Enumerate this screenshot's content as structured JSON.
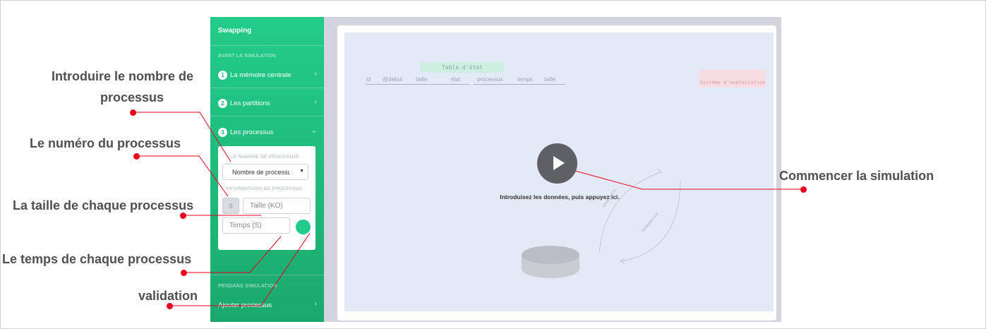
{
  "sidebar": {
    "title": "Swapping",
    "section_before": "AVANT LA SIMULATION",
    "items": [
      {
        "num": "1",
        "label": "La mémoire centrale",
        "chevron": "›"
      },
      {
        "num": "2",
        "label": "Les partitions",
        "chevron": "›"
      },
      {
        "num": "3",
        "label": "Les processus",
        "chevron": "⌄"
      }
    ],
    "panel": {
      "nb_label": "LE NOMBRE DE PROCESSUS:",
      "nb_select_value": "Nombre de processus",
      "info_label": "INFORMATIONS DU PROCESSUS:",
      "process_number": "0",
      "size_placeholder": "Taille (KO)",
      "time_placeholder": "Temps (S)"
    },
    "section_during": "PENDANS SIMULATION",
    "add_item": {
      "label": "Ajouter processus",
      "chevron": "›"
    }
  },
  "main": {
    "table_title": "Table d'état",
    "table_headers": [
      "id",
      "@debut",
      "taille",
      "état",
      "processus",
      "temps",
      "taille"
    ],
    "os_label": "Système d'exploitation",
    "intro_text": "Introduisez les données, puis appuyez ici.",
    "swap_in_label": "swapped in",
    "swap_out_label": "swapped out"
  },
  "annotations": {
    "nb_processus": "Introduire le nombre de processus",
    "nb_processus_line1": "Introduire le nombre de",
    "nb_processus_line2": "processus",
    "numero": "Le numéro du processus",
    "taille": "La taille de chaque processus",
    "temps": "Le temps de chaque processus",
    "validation": "validation",
    "commencer": "Commencer la simulation"
  },
  "colors": {
    "sidebar_green": "#1fb87a",
    "accent_green": "#22cc88",
    "annotation_red": "#e8001c",
    "canvas_bg": "#e4e9f8"
  }
}
